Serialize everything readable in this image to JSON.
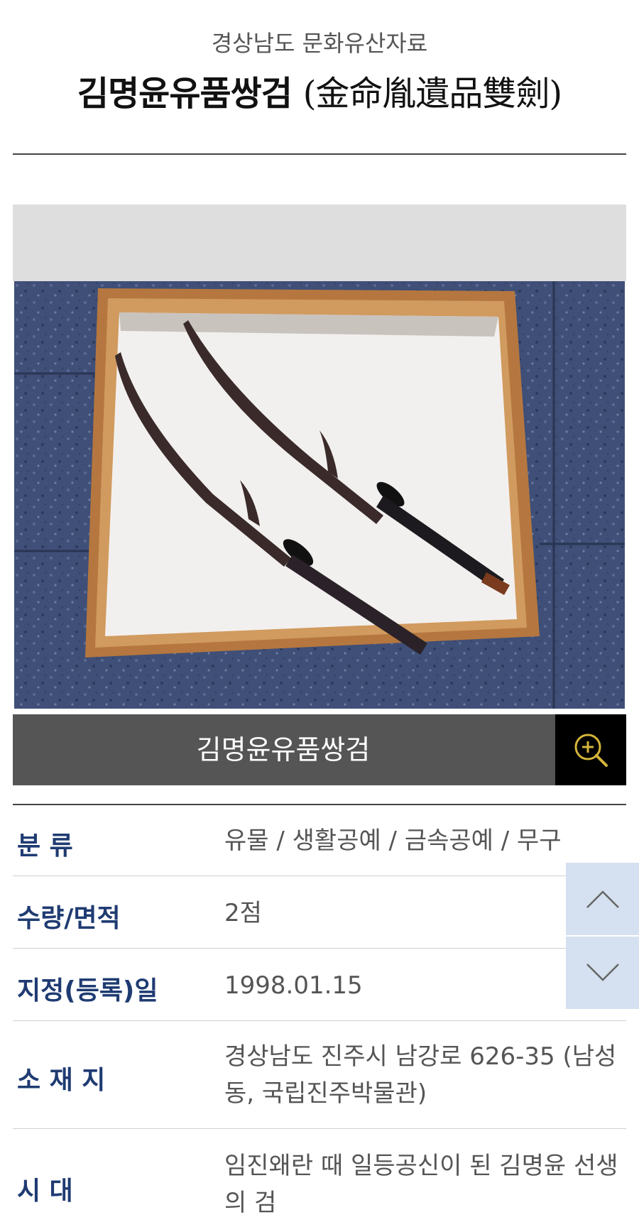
{
  "header": {
    "category": "경상남도 문화유산자료",
    "title": "김명윤유품쌍검",
    "title_hanja": "(金命胤遺品雙劍)"
  },
  "image": {
    "caption": "김명윤유품쌍검",
    "zoom_icon": "zoom-in-icon"
  },
  "info": [
    {
      "label": "분 류",
      "value": "유물 / 생활공예 / 금속공예 / 무구"
    },
    {
      "label": "수량/면적",
      "value": "2점"
    },
    {
      "label": "지정(등록)일",
      "value": "1998.01.15"
    },
    {
      "label": "소 재 지",
      "value": "경상남도 진주시 남강로 626-35 (남성동, 국립진주박물관)"
    },
    {
      "label": "시 대",
      "value": "임진왜란 때 일등공신이 된 김명윤 선생의 검"
    }
  ],
  "scroll": {
    "up_icon": "chevron-up-icon",
    "down_icon": "chevron-down-icon"
  },
  "colors": {
    "label": "#1f3b72",
    "caption_bar": "#555555",
    "scroll_button": "#d5e0f0",
    "zoom_accent": "#d4b53a"
  }
}
